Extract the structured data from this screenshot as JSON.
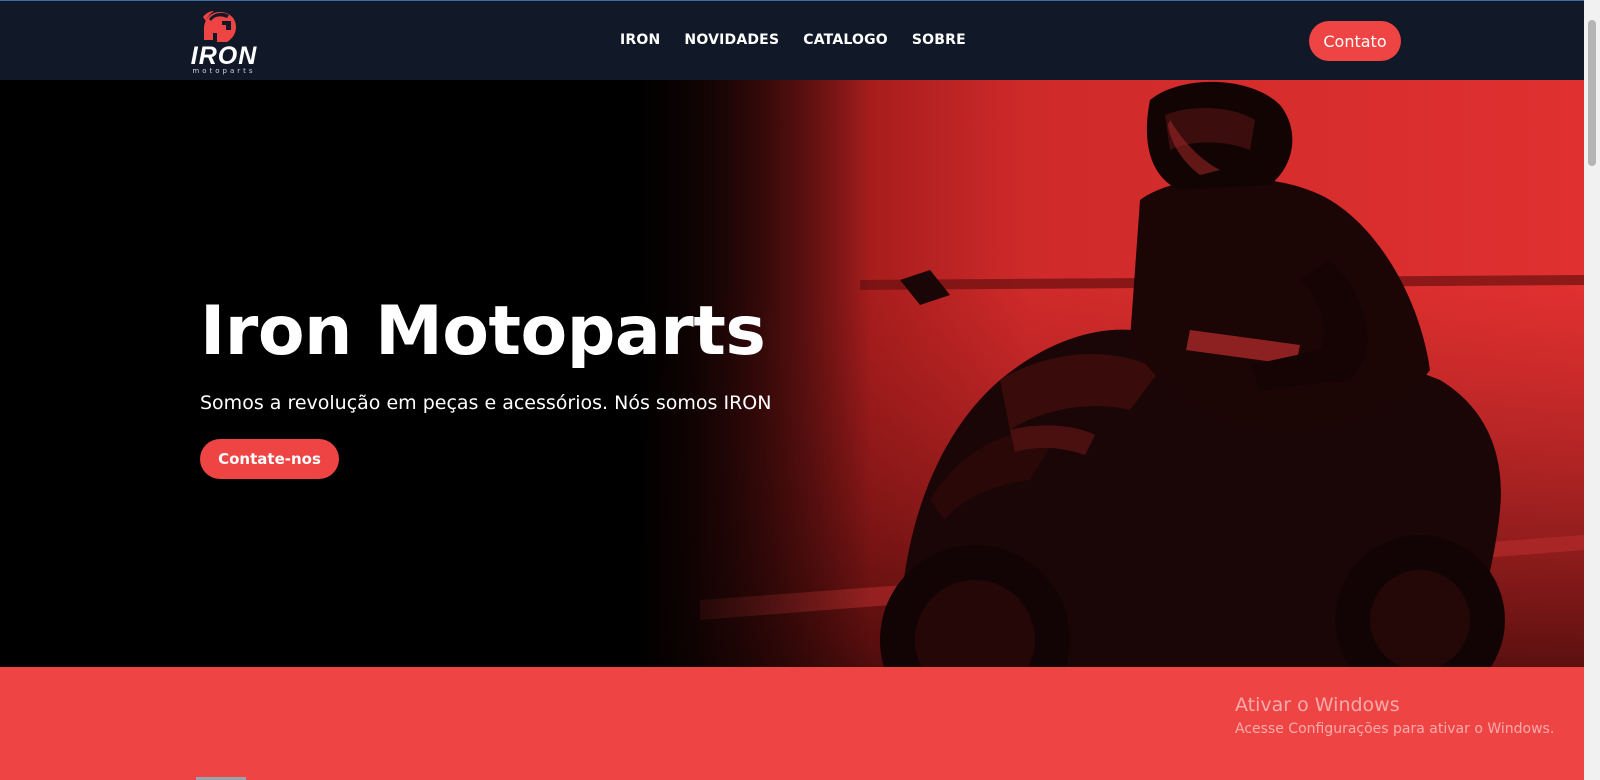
{
  "header": {
    "logo_text": "IRON",
    "logo_sub": "motoparts",
    "nav": [
      "IRON",
      "NOVIDADES",
      "CATALOGO",
      "SOBRE"
    ],
    "contact_label": "Contato"
  },
  "hero": {
    "title": "Iron Motoparts",
    "subtitle": "Somos a revolução em peças e acessórios. Nós somos IRON",
    "button_label": "Contate-nos",
    "background_icon": "motorcycle-rider-photo"
  },
  "overlay": {
    "title": "Ativar o Windows",
    "subtitle": "Acesse Configurações para ativar o Windows."
  },
  "colors": {
    "accent": "#ef4444",
    "header_bg": "#111827",
    "hero_bg": "#000000"
  }
}
